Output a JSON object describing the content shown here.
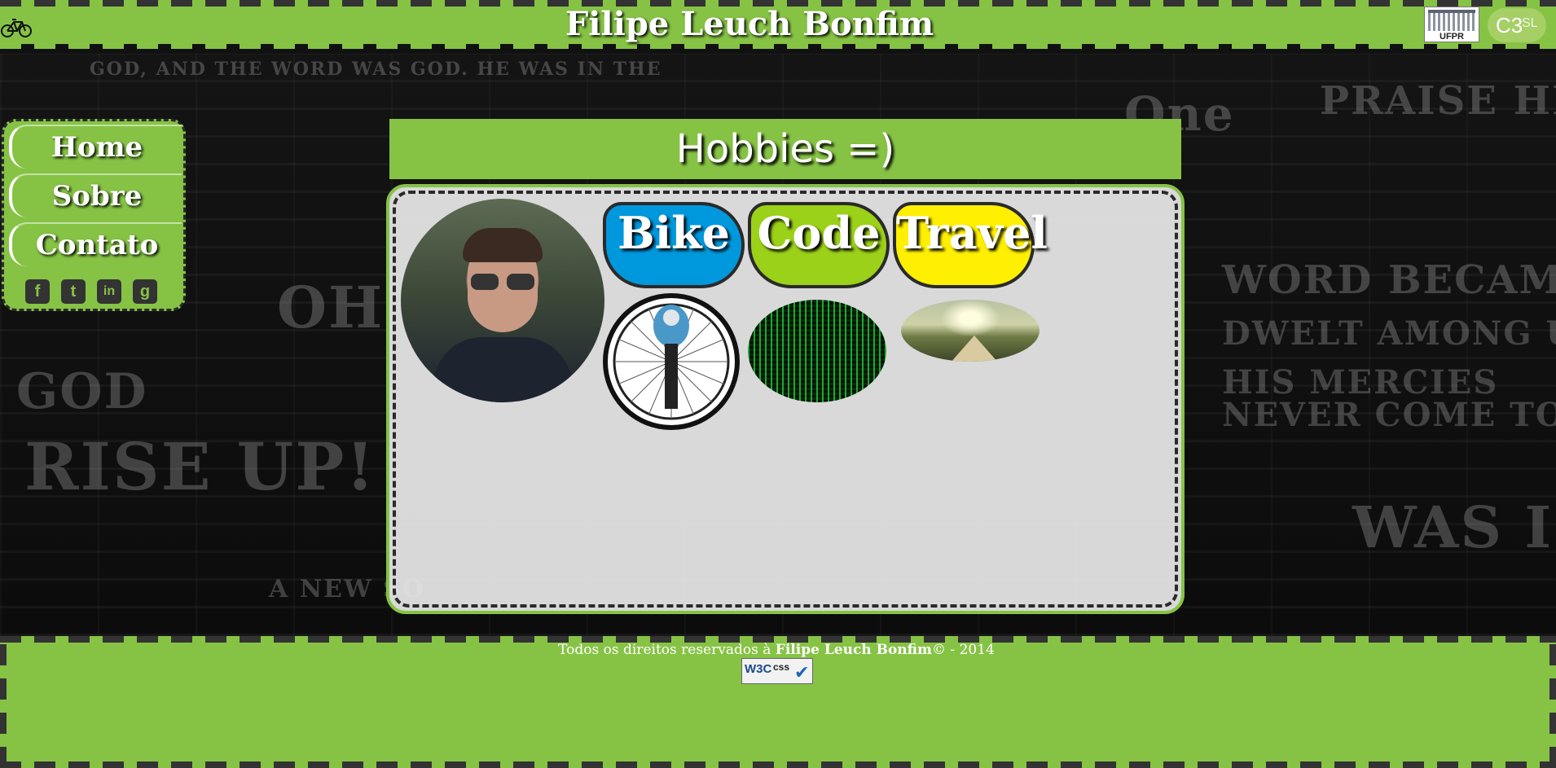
{
  "header": {
    "title": "Filipe Leuch Bonfim",
    "ufpr_logo": "UFPR",
    "c3sl_logo": {
      "c": "C3",
      "sl": "SL"
    }
  },
  "sidebar": {
    "items": [
      {
        "label": "Home"
      },
      {
        "label": "Sobre"
      },
      {
        "label": "Contato"
      }
    ],
    "social": [
      "facebook-icon",
      "twitter-icon",
      "linkedin-icon",
      "google-icon"
    ]
  },
  "main": {
    "title": "Hobbies =)",
    "hobbies": [
      {
        "label": "Bike",
        "color": "#0098dd"
      },
      {
        "label": "Code",
        "color": "#9bd118"
      },
      {
        "label": "Travel",
        "color": "#ffef00"
      }
    ]
  },
  "footer": {
    "text_prefix": "Todos os direitos reservados à ",
    "author": "Filipe Leuch Bonfim",
    "text_suffix": "© - 2014",
    "badge": {
      "w3c": "W3C",
      "css": "css"
    }
  },
  "colors": {
    "accent": "#86c345",
    "dark": "#2a2a2a"
  }
}
